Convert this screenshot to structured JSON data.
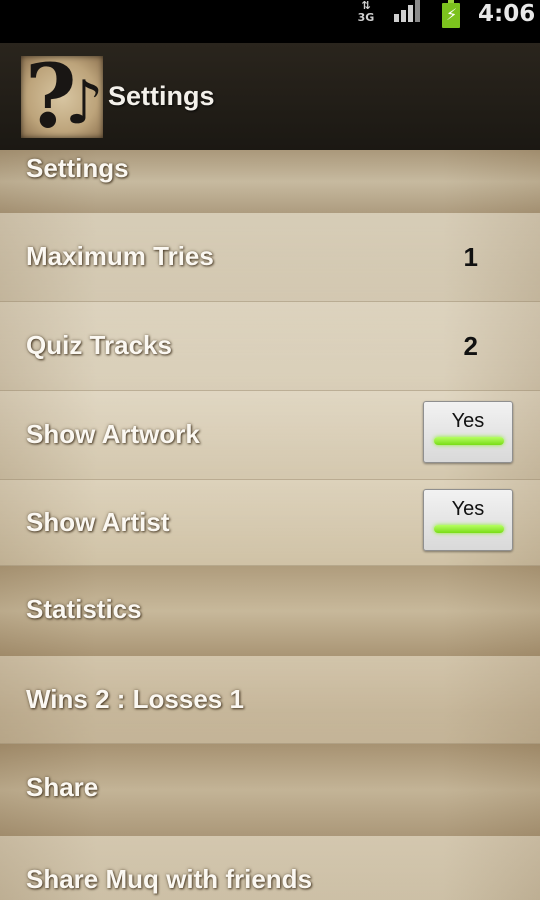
{
  "status_bar": {
    "network": "3G",
    "time": "4:06"
  },
  "title_bar": {
    "title": "Settings",
    "logo_icon": "music-question-logo"
  },
  "sections": {
    "settings_header": "Settings",
    "maximum_tries": {
      "label": "Maximum Tries",
      "value": "1"
    },
    "quiz_tracks": {
      "label": "Quiz Tracks",
      "value": "2"
    },
    "show_artwork": {
      "label": "Show Artwork",
      "toggle": "Yes",
      "on": true
    },
    "show_artist": {
      "label": "Show Artist",
      "toggle": "Yes",
      "on": true
    },
    "statistics_header": "Statistics",
    "stats_text": "Wins 2 : Losses 1",
    "share_header": "Share",
    "share_item": "Share Muq with friends"
  },
  "colors": {
    "toggle_on": "#79dd16",
    "battery": "#7cc21e"
  }
}
